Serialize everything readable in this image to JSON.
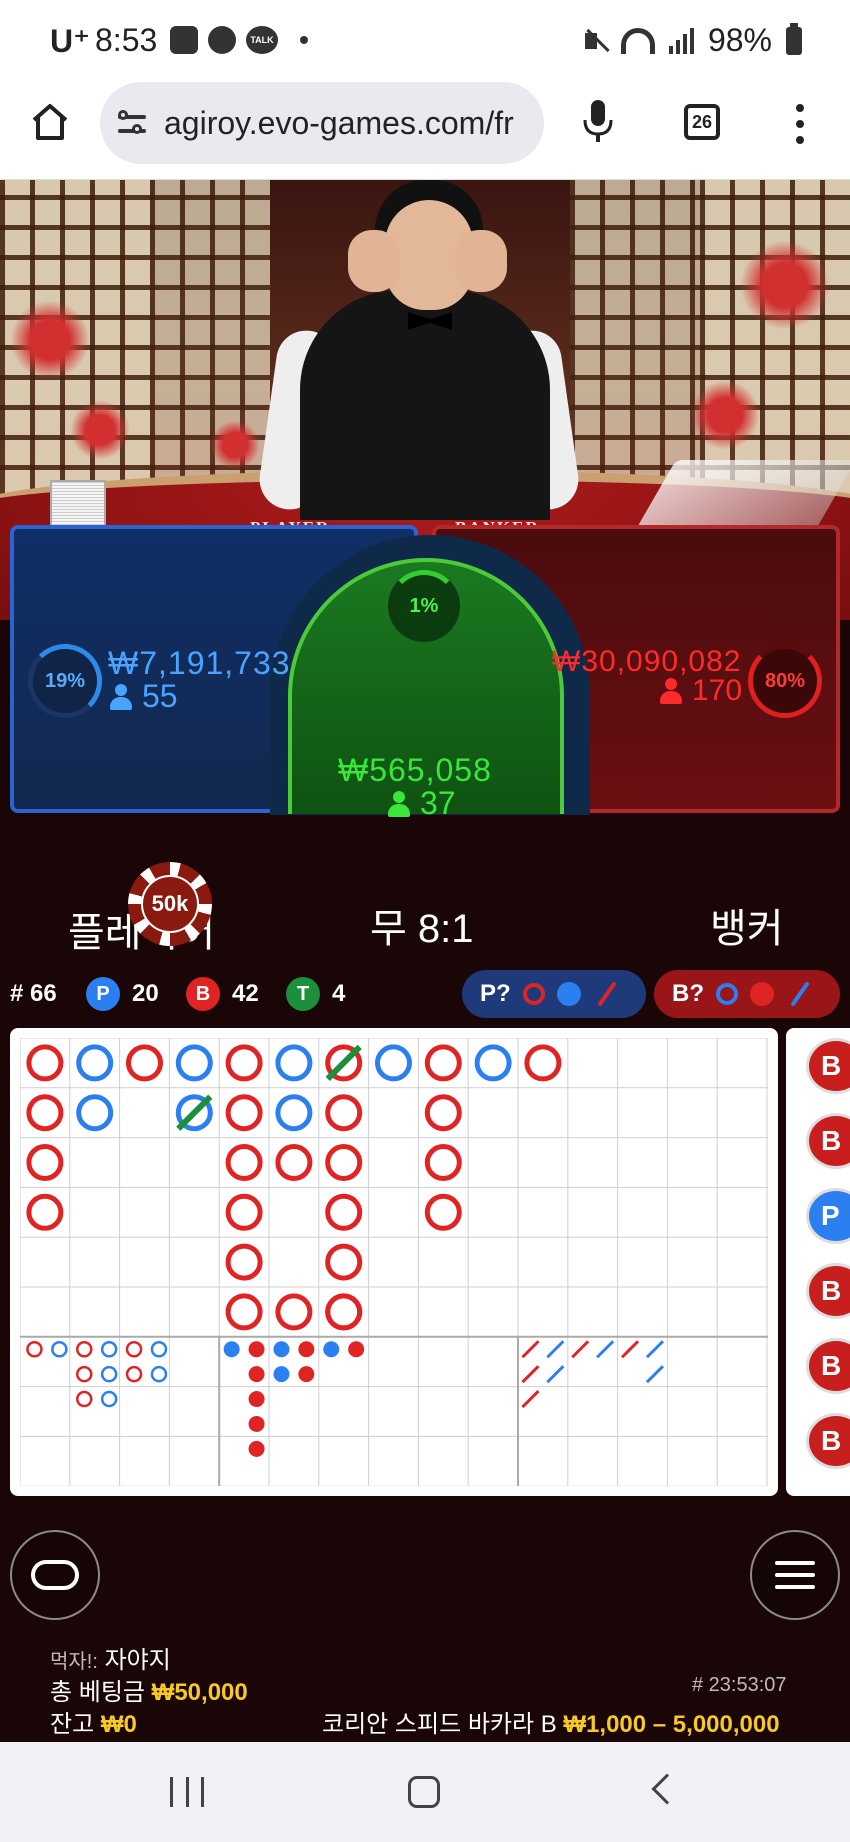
{
  "status_bar": {
    "carrier": "U⁺",
    "time": "8:53",
    "battery": "98%"
  },
  "browser": {
    "url": "agiroy.evo-games.com/fr",
    "tab_count": "26"
  },
  "table": {
    "felt_player": "PLAYER",
    "felt_banker": "BANKER"
  },
  "bets": {
    "player": {
      "percent": "19%",
      "amount": "₩7,191,733",
      "players": "55",
      "label": "플레이어"
    },
    "tie": {
      "percent": "1%",
      "amount": "₩565,058",
      "players": "37",
      "label": "무 8:1"
    },
    "banker": {
      "percent": "80%",
      "amount": "₩30,090,082",
      "players": "170",
      "label": "뱅커"
    },
    "chip": "50k"
  },
  "stats": {
    "round": "# 66",
    "player_badge": "P",
    "player_count": "20",
    "banker_badge": "B",
    "banker_count": "42",
    "tie_badge": "T",
    "tie_count": "4",
    "player_predict": "P?",
    "banker_predict": "B?"
  },
  "side_road": [
    "B",
    "B",
    "P",
    "B",
    "B",
    "B"
  ],
  "footer": {
    "winner_label": "먹자!:",
    "winner_name": "자야지",
    "total_bet_label": "총 베팅금",
    "total_bet": "₩50,000",
    "balance_label": "잔고",
    "balance": "₩0",
    "round_id": "# 23:53:07",
    "table_name": "코리안 스피드 바카라 B",
    "limits": "₩1,000 – 5,000,000"
  },
  "colors": {
    "player": "#2c7ff0",
    "banker": "#e02424",
    "tie": "#1c8f3a",
    "gold": "#f6c925"
  },
  "icons": [
    "home-icon",
    "tune-icon",
    "mic-icon",
    "kebab-menu-icon",
    "chat-icon",
    "hamburger-menu-icon"
  ]
}
